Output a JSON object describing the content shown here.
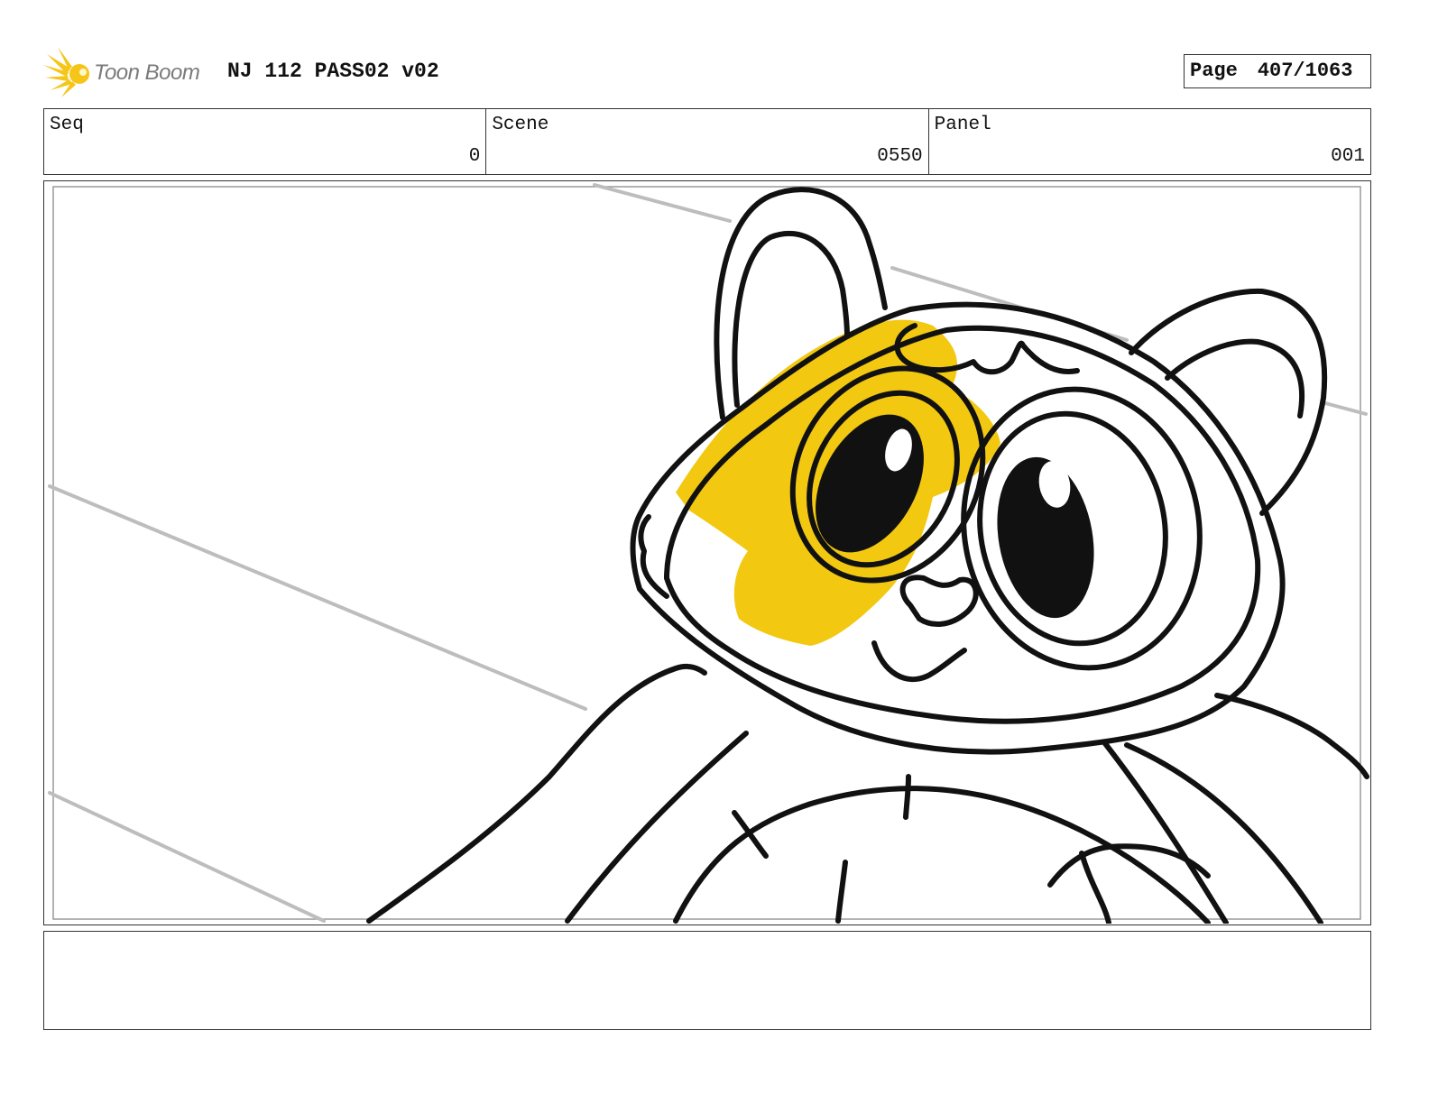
{
  "header": {
    "logo_text": "Toon Boom",
    "project_title": "NJ 112 PASS02 v02",
    "page_label": "Page",
    "page_number": "407/1063"
  },
  "fields": {
    "seq": {
      "label": "Seq",
      "value": "0"
    },
    "scene": {
      "label": "Scene",
      "value": "0550"
    },
    "panel": {
      "label": "Panel",
      "value": "001"
    }
  },
  "notes": {
    "text": ""
  },
  "colors": {
    "logo_accent": "#f5c518",
    "eye_patch": "#f2c811",
    "line_art": "#111111",
    "guide_lines": "#bbbbbb"
  }
}
